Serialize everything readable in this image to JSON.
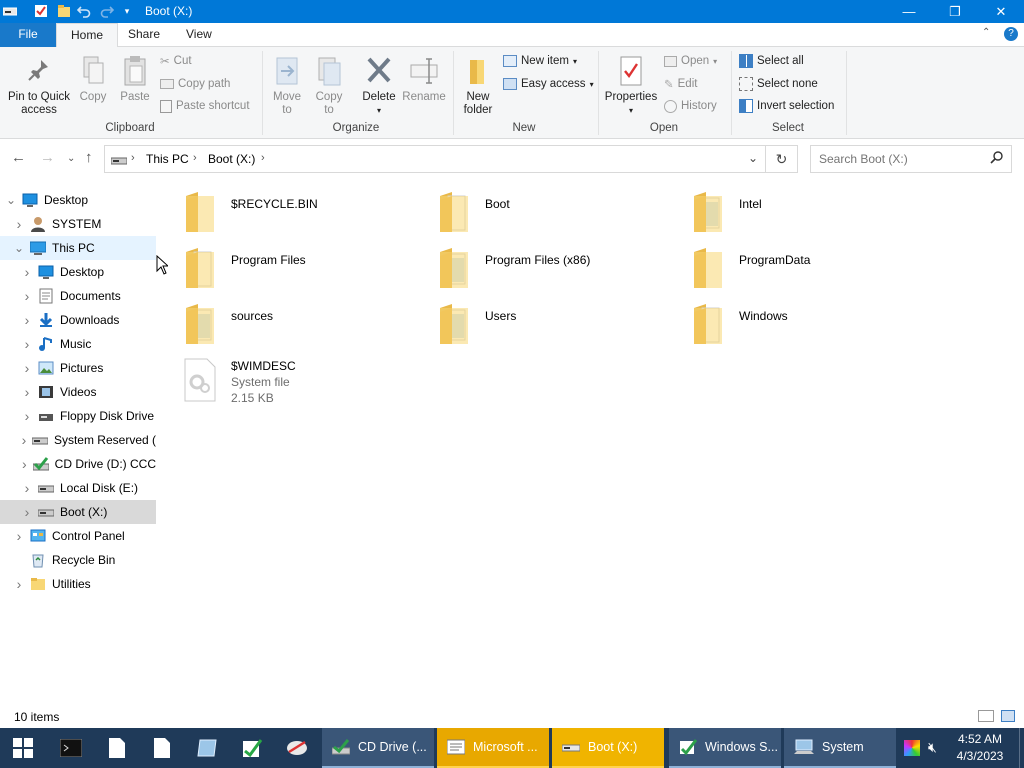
{
  "window": {
    "title": "Boot (X:)",
    "min_glyph": "—",
    "max_glyph": "❐",
    "close_glyph": "✕"
  },
  "menu": {
    "file": "File",
    "home": "Home",
    "share": "Share",
    "view": "View"
  },
  "ribbon": {
    "clipboard": {
      "group": "Clipboard",
      "pin": "Pin to Quick access",
      "copy": "Copy",
      "paste": "Paste",
      "cut": "Cut",
      "copy_path": "Copy path",
      "paste_shortcut": "Paste shortcut"
    },
    "organize": {
      "group": "Organize",
      "move_to": "Move to",
      "copy_to": "Copy to",
      "delete": "Delete",
      "rename": "Rename"
    },
    "new": {
      "group": "New",
      "new_folder": "New folder",
      "new_item": "New item",
      "easy_access": "Easy access"
    },
    "open": {
      "group": "Open",
      "properties": "Properties",
      "open": "Open",
      "edit": "Edit",
      "history": "History"
    },
    "select": {
      "group": "Select",
      "select_all": "Select all",
      "select_none": "Select none",
      "invert": "Invert selection"
    }
  },
  "address": {
    "crumbs": [
      "This PC",
      "Boot (X:)"
    ],
    "search_placeholder": "Search Boot (X:)"
  },
  "nav": [
    {
      "label": "Desktop",
      "indent": 0,
      "expander": "open",
      "icon": "desktop-icon"
    },
    {
      "label": "SYSTEM",
      "indent": 1,
      "expander": "closed",
      "icon": "user-icon"
    },
    {
      "label": "This PC",
      "indent": 1,
      "expander": "open",
      "icon": "computer-icon",
      "state": "hover"
    },
    {
      "label": "Desktop",
      "indent": 2,
      "expander": "closed",
      "icon": "desktop-icon"
    },
    {
      "label": "Documents",
      "indent": 2,
      "expander": "closed",
      "icon": "documents-icon"
    },
    {
      "label": "Downloads",
      "indent": 2,
      "expander": "closed",
      "icon": "downloads-icon"
    },
    {
      "label": "Music",
      "indent": 2,
      "expander": "closed",
      "icon": "music-icon"
    },
    {
      "label": "Pictures",
      "indent": 2,
      "expander": "closed",
      "icon": "pictures-icon"
    },
    {
      "label": "Videos",
      "indent": 2,
      "expander": "closed",
      "icon": "videos-icon"
    },
    {
      "label": "Floppy Disk Drive",
      "indent": 2,
      "expander": "closed",
      "icon": "floppy-icon"
    },
    {
      "label": "System Reserved (",
      "indent": 2,
      "expander": "closed",
      "icon": "drive-icon"
    },
    {
      "label": "CD Drive (D:) CCC",
      "indent": 2,
      "expander": "closed",
      "icon": "cd-drive-icon"
    },
    {
      "label": "Local Disk (E:)",
      "indent": 2,
      "expander": "closed",
      "icon": "drive-icon"
    },
    {
      "label": "Boot (X:)",
      "indent": 2,
      "expander": "closed",
      "icon": "drive-icon",
      "state": "selected"
    },
    {
      "label": "Control Panel",
      "indent": 1,
      "expander": "closed",
      "icon": "control-panel-icon"
    },
    {
      "label": "Recycle Bin",
      "indent": 1,
      "expander": "none",
      "icon": "recycle-bin-icon"
    },
    {
      "label": "Utilities",
      "indent": 1,
      "expander": "closed",
      "icon": "folder-icon"
    }
  ],
  "items": [
    {
      "name": "$RECYCLE.BIN",
      "kind": "folder-empty"
    },
    {
      "name": "Boot",
      "kind": "folder-doc"
    },
    {
      "name": "Intel",
      "kind": "folder-full"
    },
    {
      "name": "Program Files",
      "kind": "folder-doc"
    },
    {
      "name": "Program Files (x86)",
      "kind": "folder-full"
    },
    {
      "name": "ProgramData",
      "kind": "folder-empty"
    },
    {
      "name": "sources",
      "kind": "folder-full"
    },
    {
      "name": "Users",
      "kind": "folder-full"
    },
    {
      "name": "Windows",
      "kind": "folder-doc"
    }
  ],
  "file_item": {
    "name": "$WIMDESC",
    "type": "System file",
    "size": "2.15 KB"
  },
  "status": {
    "count": "10 items"
  },
  "taskbar": {
    "buttons": [
      {
        "label": "CD Drive (...",
        "state": "normal",
        "icon": "cd-drive-icon"
      },
      {
        "label": "Microsoft ...",
        "state": "highlight",
        "icon": "window-icon"
      },
      {
        "label": "Boot (X:)",
        "state": "active",
        "icon": "drive-icon"
      },
      {
        "label": "Windows S...",
        "state": "normal",
        "icon": "setup-icon"
      },
      {
        "label": "System",
        "state": "normal",
        "icon": "system-icon"
      }
    ],
    "time": "4:52 AM",
    "date": "4/3/2023"
  },
  "colors": {
    "titlebar": "#0078d7",
    "taskbar": "#1f3a59",
    "taskbar_highlight": "#f0b400",
    "folder": "#f8d775"
  }
}
